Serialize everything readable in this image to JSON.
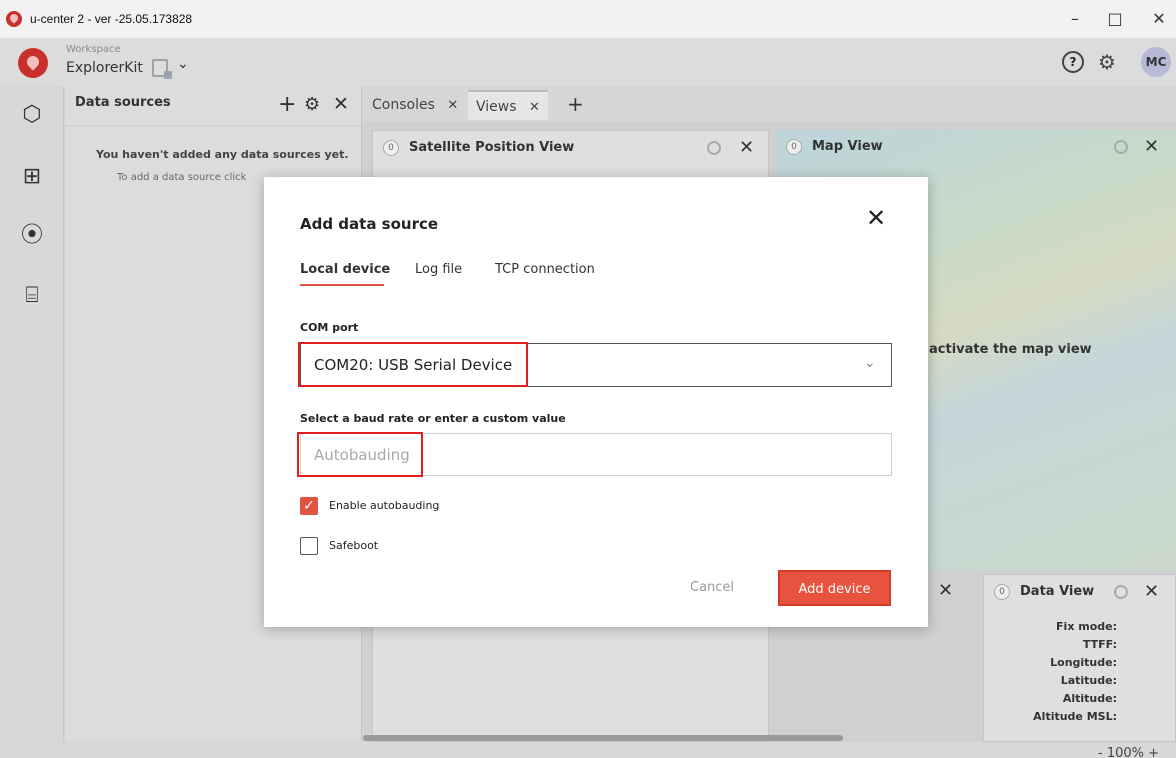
{
  "window": {
    "title": "u-center 2 - ver -25.05.173828",
    "minimize_glyph": "–",
    "maximize_glyph": "□",
    "close_glyph": "✕"
  },
  "workspace": {
    "label": "Workspace",
    "name": "ExplorerKit",
    "chevron": "⌄",
    "help_glyph": "?",
    "settings_glyph": "⚙",
    "avatar_initials": "MC"
  },
  "leftrail": {
    "items": [
      {
        "icon": "chip-icon",
        "glyph": "⬡"
      },
      {
        "icon": "add-widget-icon",
        "glyph": "⊞"
      },
      {
        "icon": "gauge-icon",
        "glyph": "⦿"
      },
      {
        "icon": "toolbox-icon",
        "glyph": "⌸"
      }
    ]
  },
  "data_sources": {
    "title": "Data sources",
    "add_glyph": "+",
    "settings_glyph": "⚙",
    "close_glyph": "✕",
    "empty_text": "You haven't added any data sources yet.",
    "hint_text": "To add a data source click"
  },
  "tabs": [
    {
      "label": "Consoles",
      "close": "✕"
    },
    {
      "label": "Views",
      "close": "✕"
    }
  ],
  "add_tab_glyph": "+",
  "views": {
    "satellite": {
      "badge": "0",
      "title": "Satellite Position View"
    },
    "map": {
      "badge": "0",
      "title": "Map View",
      "overlay_text": "activate the map view"
    },
    "data_view": {
      "badge": "0",
      "title": "Data View",
      "fields": [
        "Fix mode:",
        "TTFF:",
        "Longitude:",
        "Latitude:",
        "Altitude:",
        "Altitude MSL:"
      ]
    },
    "close_glyph": "✕"
  },
  "status": {
    "zoom": "- 100% +"
  },
  "dialog": {
    "title": "Add data source",
    "close_glyph": "✕",
    "tabs": [
      "Local device",
      "Log file",
      "TCP connection"
    ],
    "com_port_label": "COM port",
    "com_port_value": "COM20: USB Serial Device",
    "com_chevron": "⌄",
    "baud_label": "Select a baud rate or enter a custom value",
    "baud_placeholder": "Autobauding",
    "enable_autobauding_label": "Enable autobauding",
    "enable_autobauding_checked": true,
    "checkmark": "✓",
    "safeboot_label": "Safeboot",
    "safeboot_checked": false,
    "cancel_label": "Cancel",
    "add_label": "Add device",
    "accent_color": "#e8533f"
  }
}
